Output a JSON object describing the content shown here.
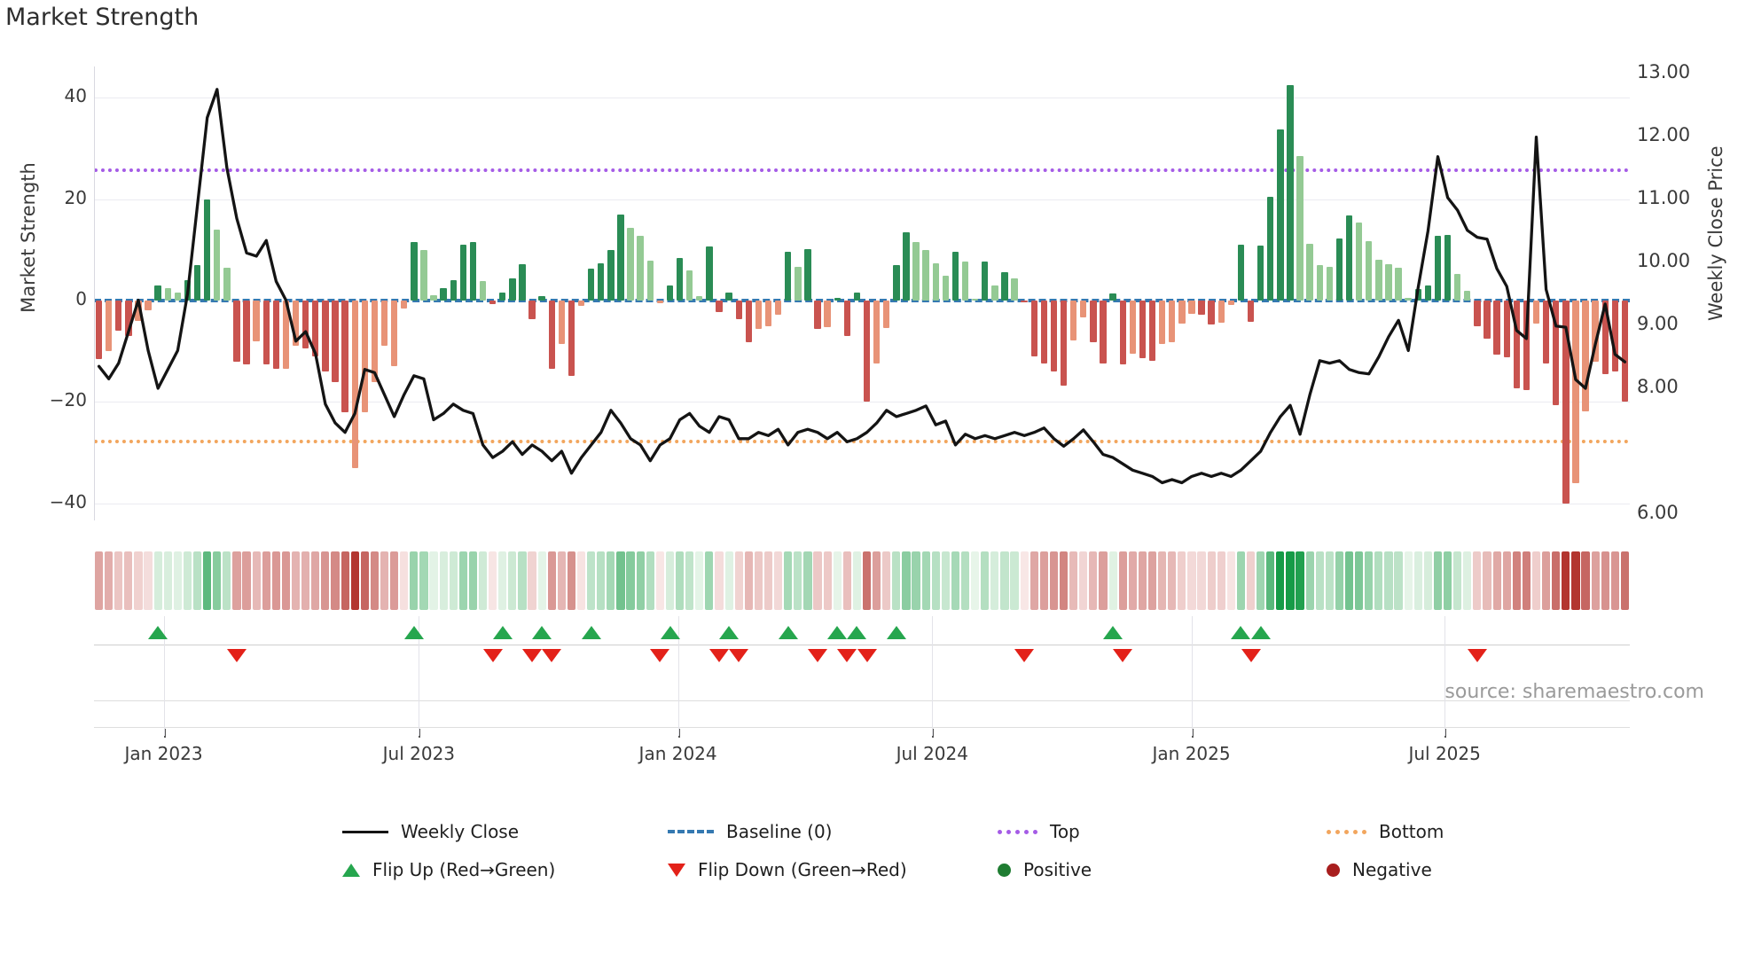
{
  "title": "Market Strength",
  "source": "source: sharemaestro.com",
  "axes": {
    "left_label": "Market Strength",
    "right_label": "Weekly Close Price",
    "left_ticks": [
      40,
      20,
      0,
      -20,
      -40
    ],
    "right_ticks": [
      "13.00",
      "12.00",
      "11.00",
      "10.00",
      "9.00",
      "8.00",
      "6.00"
    ],
    "x_ticks": [
      "Jan 2023",
      "Jul 2023",
      "Jan 2024",
      "Jul 2024",
      "Jan 2025",
      "Jul 2025"
    ]
  },
  "legend": {
    "row1": [
      {
        "label": "Weekly Close",
        "swatch": "line"
      },
      {
        "label": "Baseline (0)",
        "swatch": "dash"
      },
      {
        "label": "Top",
        "swatch": "dots-purple"
      },
      {
        "label": "Bottom",
        "swatch": "dots-orange"
      }
    ],
    "row2": [
      {
        "label": "Flip Up (Red→Green)",
        "swatch": "tri-up"
      },
      {
        "label": "Flip Down (Green→Red)",
        "swatch": "tri-down"
      },
      {
        "label": "Positive",
        "swatch": "circle-green"
      },
      {
        "label": "Negative",
        "swatch": "circle-red"
      }
    ]
  },
  "colors": {
    "bar_dark_green": "#2a8c55",
    "bar_light_green": "#94ca94",
    "bar_dark_red": "#c9534f",
    "bar_salmon": "#e89377",
    "baseline": "#3579b1",
    "top_line": "#a55ce6",
    "bottom_line": "#f2a65e",
    "price_line": "#141414",
    "flip_up": "#26a64e",
    "flip_down": "#e32119",
    "positive_dot": "#1f7d32",
    "negative_dot": "#a81e1e",
    "heat_pos_hi": "#169b47",
    "heat_pos_lo": "#eaf6eb",
    "heat_neg_hi": "#b33630",
    "heat_neg_lo": "#f9e9e8"
  },
  "chart_data": {
    "type": "bar+line composite, weekly",
    "title": "Market Strength",
    "x_axis": {
      "tick_labels": [
        "Jan 2023",
        "Jul 2023",
        "Jan 2024",
        "Jul 2024",
        "Jan 2025",
        "Jul 2025"
      ],
      "tick_week_index": [
        6.1,
        32.1,
        58.5,
        84.4,
        110.8,
        136.6
      ],
      "n_weeks": 156,
      "start": "late Nov 2022",
      "end": "mid Nov 2025"
    },
    "left_axis": {
      "label": "Market Strength",
      "range": [
        -45.5,
        46.2
      ],
      "ticks": [
        40,
        20,
        0,
        -20,
        -40
      ]
    },
    "right_axis": {
      "label": "Weekly Close Price",
      "range": [
        5.79,
        13.11
      ],
      "ticks": [
        13,
        12,
        11,
        10,
        9,
        8,
        6
      ]
    },
    "baseline": 0,
    "top_level_strength": 25.7,
    "bottom_level_strength": -27.6,
    "series": [
      {
        "name": "Market Strength bars",
        "type": "bar",
        "note": "shade: G=dark green, L=light green, R=dark red, S=salmon",
        "values": [
          -11.5,
          -10,
          -6,
          -7,
          -4,
          -2,
          3,
          2.5,
          1.5,
          4,
          7,
          20,
          14,
          6.5,
          -12,
          -12.5,
          -8,
          -12.5,
          -13.5,
          -13.5,
          -9,
          -9.5,
          -11,
          -14,
          -16,
          -22,
          -33,
          -22,
          -16,
          -9,
          -13,
          -1.5,
          11.5,
          10,
          1,
          2.5,
          4,
          11,
          11.5,
          3.8,
          -0.7,
          1.5,
          4.3,
          7.2,
          -3.7,
          0.8,
          -13.5,
          -8.5,
          -14.8,
          -1,
          6.3,
          7.3,
          9.9,
          17,
          14.3,
          12.8,
          7.9,
          -0.5,
          2.9,
          8.4,
          6,
          0.8,
          10.7,
          -2.2,
          1.5,
          -3.7,
          -8.3,
          -5.6,
          -5.1,
          -2.8,
          9.7,
          6.6,
          10.1,
          -5.6,
          -5.3,
          0.6,
          -7,
          1.5,
          -20,
          -12.4,
          -5.4,
          7,
          13.5,
          11.5,
          10,
          7.3,
          4.9,
          9.6,
          7.7,
          0.4,
          7.7,
          3,
          5.6,
          4.4,
          -0.3,
          -11,
          -12.4,
          -14,
          -16.8,
          -7.9,
          -3.3,
          -8.2,
          -12.4,
          1.4,
          -12.6,
          -10.5,
          -11.3,
          -11.9,
          -8.6,
          -8.2,
          -4.5,
          -2.6,
          -2.8,
          -4.7,
          -4.3,
          -0.8,
          11,
          -4.2,
          10.8,
          20.5,
          33.7,
          42.5,
          28.5,
          11.2,
          7,
          6.7,
          12.2,
          16.8,
          15.4,
          11.7,
          8,
          7.2,
          6.5,
          0.5,
          2.2,
          2.9,
          12.8,
          13,
          5.3,
          1.9,
          -5.1,
          -7.6,
          -10.7,
          -11.2,
          -17.3,
          -17.7,
          -4.5,
          -12.4,
          -20.6,
          -40,
          -36,
          -21.9,
          -12.1,
          -14.5,
          -13.9,
          -20
        ],
        "shades": [
          "R",
          "S",
          "R",
          "R",
          "S",
          "S",
          "G",
          "L",
          "L",
          "G",
          "G",
          "G",
          "L",
          "L",
          "R",
          "R",
          "S",
          "R",
          "R",
          "S",
          "S",
          "R",
          "R",
          "R",
          "R",
          "R",
          "S",
          "S",
          "S",
          "S",
          "S",
          "S",
          "G",
          "L",
          "L",
          "G",
          "G",
          "G",
          "G",
          "L",
          "R",
          "G",
          "G",
          "G",
          "R",
          "G",
          "R",
          "S",
          "R",
          "S",
          "G",
          "G",
          "G",
          "G",
          "L",
          "L",
          "L",
          "S",
          "G",
          "G",
          "L",
          "L",
          "G",
          "R",
          "G",
          "R",
          "R",
          "S",
          "S",
          "S",
          "G",
          "L",
          "G",
          "R",
          "S",
          "G",
          "R",
          "G",
          "R",
          "S",
          "S",
          "G",
          "G",
          "L",
          "L",
          "L",
          "L",
          "G",
          "L",
          "L",
          "G",
          "L",
          "G",
          "L",
          "R",
          "R",
          "R",
          "R",
          "R",
          "S",
          "S",
          "R",
          "R",
          "G",
          "R",
          "S",
          "R",
          "R",
          "S",
          "S",
          "S",
          "S",
          "R",
          "R",
          "S",
          "S",
          "G",
          "R",
          "G",
          "G",
          "G",
          "G",
          "L",
          "L",
          "L",
          "L",
          "G",
          "G",
          "L",
          "L",
          "L",
          "L",
          "L",
          "L",
          "G",
          "G",
          "G",
          "G",
          "L",
          "L",
          "R",
          "R",
          "R",
          "R",
          "R",
          "R",
          "S",
          "R",
          "R",
          "R",
          "S",
          "S",
          "S",
          "R",
          "R",
          "R"
        ]
      },
      {
        "name": "Weekly Close",
        "type": "line",
        "values": [
          8.35,
          8.15,
          8.4,
          8.9,
          9.4,
          8.6,
          8.0,
          8.3,
          8.6,
          9.5,
          10.9,
          12.3,
          12.75,
          11.5,
          10.7,
          10.15,
          10.1,
          10.35,
          9.7,
          9.4,
          8.75,
          8.9,
          8.55,
          7.75,
          7.45,
          7.3,
          7.6,
          8.3,
          8.25,
          7.9,
          7.55,
          7.9,
          8.2,
          8.15,
          7.5,
          7.6,
          7.75,
          7.65,
          7.6,
          7.1,
          6.9,
          7.0,
          7.15,
          6.95,
          7.1,
          7.0,
          6.85,
          7.0,
          6.65,
          6.9,
          7.1,
          7.3,
          7.65,
          7.45,
          7.2,
          7.1,
          6.85,
          7.1,
          7.2,
          7.5,
          7.6,
          7.4,
          7.3,
          7.55,
          7.5,
          7.2,
          7.2,
          7.3,
          7.25,
          7.35,
          7.1,
          7.3,
          7.35,
          7.3,
          7.2,
          7.3,
          7.15,
          7.2,
          7.3,
          7.45,
          7.65,
          7.55,
          7.6,
          7.65,
          7.72,
          7.42,
          7.48,
          7.1,
          7.27,
          7.2,
          7.25,
          7.2,
          7.25,
          7.3,
          7.25,
          7.3,
          7.37,
          7.2,
          7.08,
          7.2,
          7.34,
          7.15,
          6.95,
          6.9,
          6.8,
          6.7,
          6.65,
          6.6,
          6.5,
          6.55,
          6.5,
          6.6,
          6.65,
          6.6,
          6.65,
          6.6,
          6.7,
          6.85,
          7.0,
          7.3,
          7.55,
          7.73,
          7.27,
          7.9,
          8.44,
          8.4,
          8.44,
          8.3,
          8.25,
          8.23,
          8.5,
          8.82,
          9.08,
          8.6,
          9.6,
          10.5,
          11.68,
          11.03,
          10.83,
          10.51,
          10.4,
          10.37,
          9.9,
          9.62,
          8.92,
          8.79,
          11.99,
          9.57,
          8.99,
          8.97,
          8.14,
          8.0,
          8.7,
          9.34,
          8.54,
          8.42
        ]
      },
      {
        "name": "Baseline (0)",
        "type": "hline-dashed",
        "value": 0
      },
      {
        "name": "Top",
        "type": "hline-dotted",
        "value_price": 11.46
      },
      {
        "name": "Bottom",
        "type": "hline-dotted",
        "value_price": 7.2
      }
    ],
    "markers": {
      "flip_up": "weeks where strength crosses 0 upward",
      "flip_down": "weeks where strength crosses 0 downward"
    },
    "heat_strip": "one cell per week, red-green intensity proportional to strength",
    "legend_position": "bottom, two rows",
    "grid": "horizontal at ±20, ±40"
  }
}
